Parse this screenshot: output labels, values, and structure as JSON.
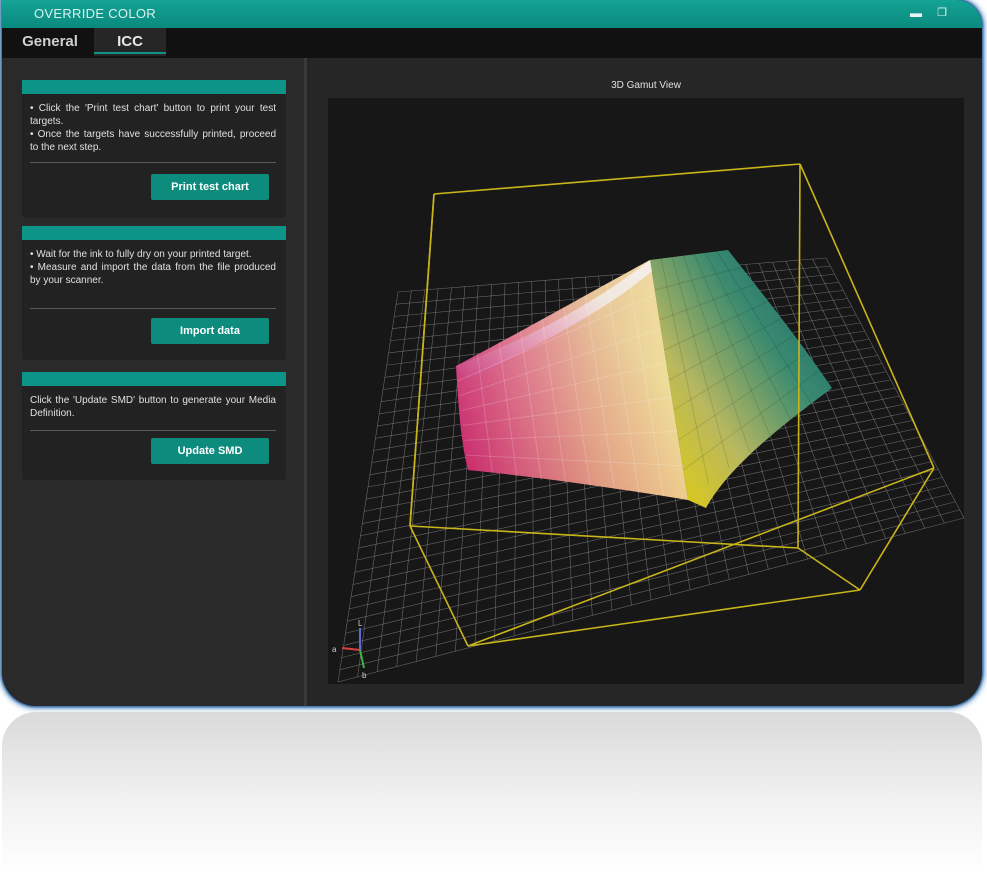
{
  "window": {
    "title": "OVERRIDE COLOR",
    "minimize_glyph": "▬",
    "maximize_glyph": "❐",
    "accent_color": "#0d9488"
  },
  "tabs": [
    {
      "label": "General",
      "active": false
    },
    {
      "label": "ICC",
      "active": true
    }
  ],
  "steps": [
    {
      "lines": [
        "• Click the 'Print test chart' button to print your test targets.",
        "• Once the targets have successfully printed, proceed to the next step."
      ],
      "button_label": "Print test chart"
    },
    {
      "lines": [
        "• Wait for the ink to fully dry on your printed target.",
        "• Measure and import the data from the file produced by your scanner."
      ],
      "button_label": "Import data"
    },
    {
      "lines": [
        "Click the 'Update SMD' button to generate your Media Definition."
      ],
      "button_label": "Update SMD"
    }
  ],
  "gamut_view": {
    "title": "3D Gamut View",
    "axis_labels": {
      "L": "L",
      "a": "a",
      "b": "b"
    },
    "box_color": "#c8b51a",
    "grid_color": "#8a8a8a"
  }
}
